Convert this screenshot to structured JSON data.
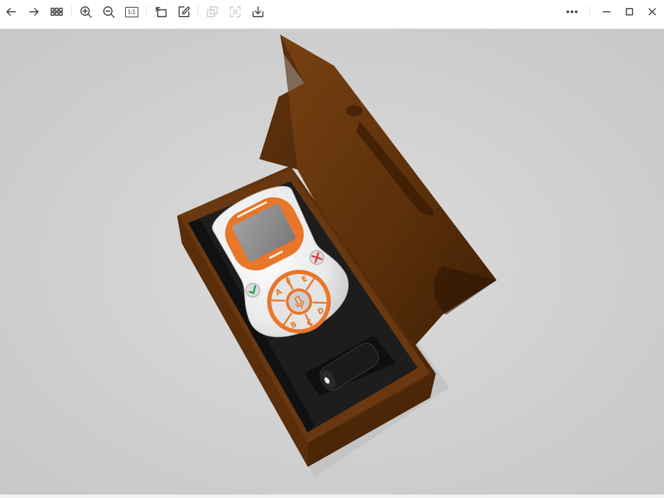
{
  "toolbar": {
    "buttons": [
      {
        "name": "back-button",
        "icon": "arrow-left-icon",
        "enabled": true
      },
      {
        "name": "forward-button",
        "icon": "arrow-right-icon",
        "enabled": true
      },
      {
        "name": "thumbnails-button",
        "icon": "grid-icon",
        "enabled": true
      },
      {
        "name": "zoom-in-button",
        "icon": "zoom-in-icon",
        "enabled": true
      },
      {
        "name": "zoom-out-button",
        "icon": "zoom-out-icon",
        "enabled": true
      },
      {
        "name": "actual-size-button",
        "icon": "actual-size-icon",
        "enabled": true
      },
      {
        "name": "rotate-button",
        "icon": "rotate-icon",
        "enabled": true
      },
      {
        "name": "edit-button",
        "icon": "edit-icon",
        "enabled": true
      },
      {
        "name": "copy-button",
        "icon": "copy-icon",
        "enabled": false
      },
      {
        "name": "ocr-button",
        "icon": "scan-text-icon",
        "enabled": false
      },
      {
        "name": "save-button",
        "icon": "download-icon",
        "enabled": true
      }
    ],
    "actual_size_label": "1:1",
    "window_controls": [
      "more-icon",
      "minimize-icon",
      "maximize-icon",
      "close-icon"
    ]
  },
  "image": {
    "description_colors": {
      "box": "#6b3a10",
      "box_dark": "#3f1f06",
      "insert": "#1c1c1c",
      "device_body": "#ececec",
      "device_accent": "#e8772a",
      "background": "#d0d0d0"
    },
    "keypad_letters": [
      "A",
      "F",
      "E",
      "B",
      "C",
      "D"
    ]
  }
}
